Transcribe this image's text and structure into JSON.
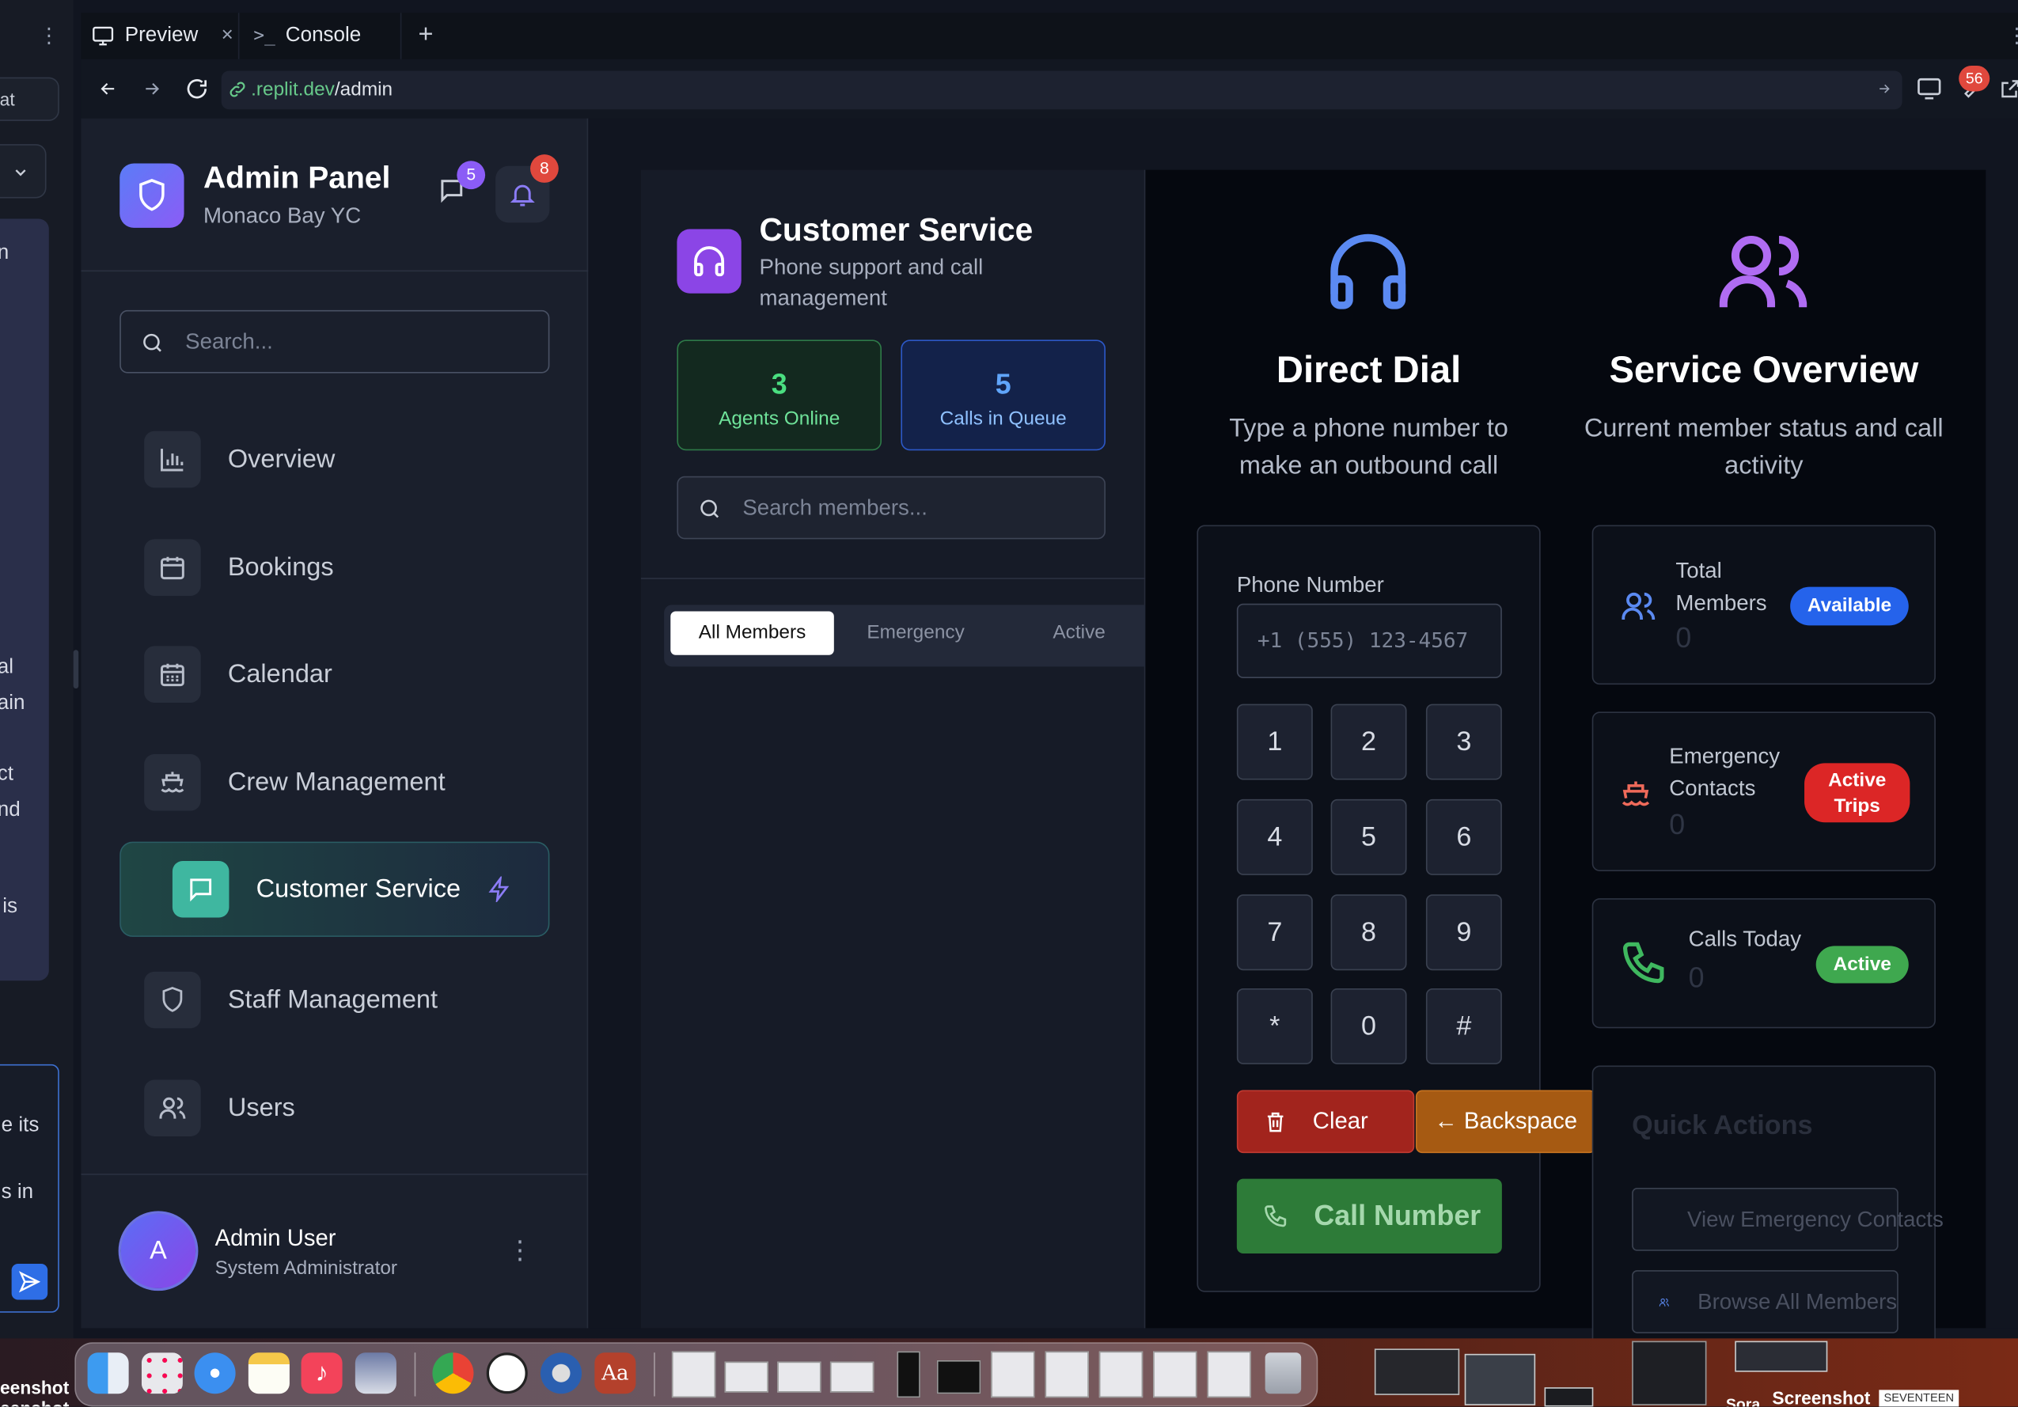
{
  "browser": {
    "tabs": [
      {
        "label": "Preview"
      },
      {
        "label": "Console"
      }
    ],
    "url_host": ".replit.dev",
    "url_path": "/admin",
    "extension_badge": "56"
  },
  "chat_strip": {
    "new_chat_label": "chat",
    "fragments": [
      "n",
      "al",
      "ain",
      "ct",
      "nd",
      "is",
      "e its",
      "s in"
    ]
  },
  "sidebar": {
    "title": "Admin Panel",
    "subtitle": "Monaco Bay YC",
    "messages_badge": "5",
    "notifications_badge": "8",
    "search_placeholder": "Search...",
    "items": [
      {
        "label": "Overview",
        "icon": "bar-chart-icon"
      },
      {
        "label": "Bookings",
        "icon": "calendar-icon"
      },
      {
        "label": "Calendar",
        "icon": "calendar-grid-icon"
      },
      {
        "label": "Crew Management",
        "icon": "ship-icon"
      },
      {
        "label": "Customer Service",
        "icon": "message-square-icon",
        "active": true
      },
      {
        "label": "Staff Management",
        "icon": "shield-icon"
      },
      {
        "label": "Users",
        "icon": "users-icon"
      }
    ],
    "user": {
      "initial": "A",
      "name": "Admin User",
      "role": "System Administrator"
    }
  },
  "customer_service": {
    "title": "Customer Service",
    "subtitle": "Phone support and call management",
    "stats": [
      {
        "value": "3",
        "label": "Agents Online",
        "color": "#4ade80"
      },
      {
        "value": "5",
        "label": "Calls in Queue",
        "color": "#60a5fa"
      }
    ],
    "member_search_placeholder": "Search members...",
    "filters": [
      "All Members",
      "Emergency",
      "Active"
    ],
    "selected_filter": "All Members"
  },
  "direct_dial": {
    "title": "Direct Dial",
    "subtitle": "Type a phone number to make an outbound call",
    "phone_label": "Phone Number",
    "phone_placeholder": "+1 (555) 123-4567",
    "keys": [
      "1",
      "2",
      "3",
      "4",
      "5",
      "6",
      "7",
      "8",
      "9",
      "*",
      "0",
      "#"
    ],
    "clear_label": "Clear",
    "backspace_label": "← Backspace",
    "call_label": "Call Number"
  },
  "service_overview": {
    "title": "Service Overview",
    "subtitle": "Current member status and call activity",
    "cards": [
      {
        "label": "Total Members",
        "value": "0",
        "status": "Available",
        "status_color": "#2563eb"
      },
      {
        "label": "Emergency Contacts",
        "value": "0",
        "status": "Active Trips",
        "status_color": "#dc2626"
      },
      {
        "label": "Calls Today",
        "value": "0",
        "status": "Active",
        "status_color": "#3fa84f"
      }
    ],
    "quick_actions_title": "Quick Actions",
    "quick_actions": [
      "View Emergency Contacts",
      "Browse All Members"
    ]
  },
  "dock": {
    "left_labels": [
      "eenshot",
      "eenshot"
    ],
    "right_label": "Screenshot",
    "right_sub": "Sora",
    "right_tag": "SEVENTEEN"
  }
}
